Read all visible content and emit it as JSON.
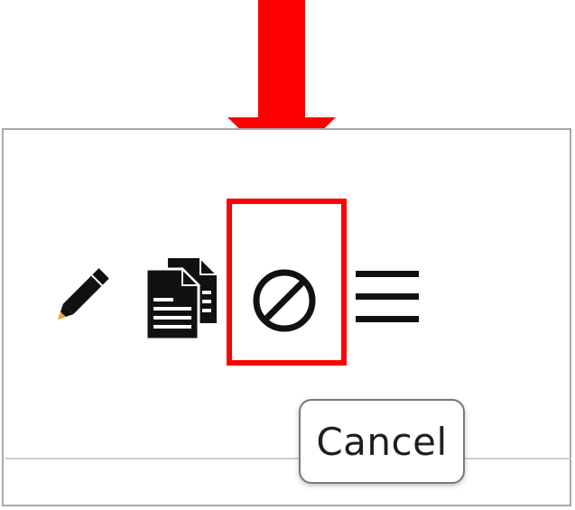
{
  "toolbar": {
    "icons": [
      "pencil-icon",
      "copy-icon",
      "cancel-icon",
      "menu-icon"
    ]
  },
  "tooltip": {
    "text": "Cancel"
  },
  "colors": {
    "annotation": "#ff0000",
    "icon": "#111111",
    "pencil_tip": "#f5a623",
    "panel_border": "#a9a9a9",
    "divider": "#c9d2dc"
  }
}
